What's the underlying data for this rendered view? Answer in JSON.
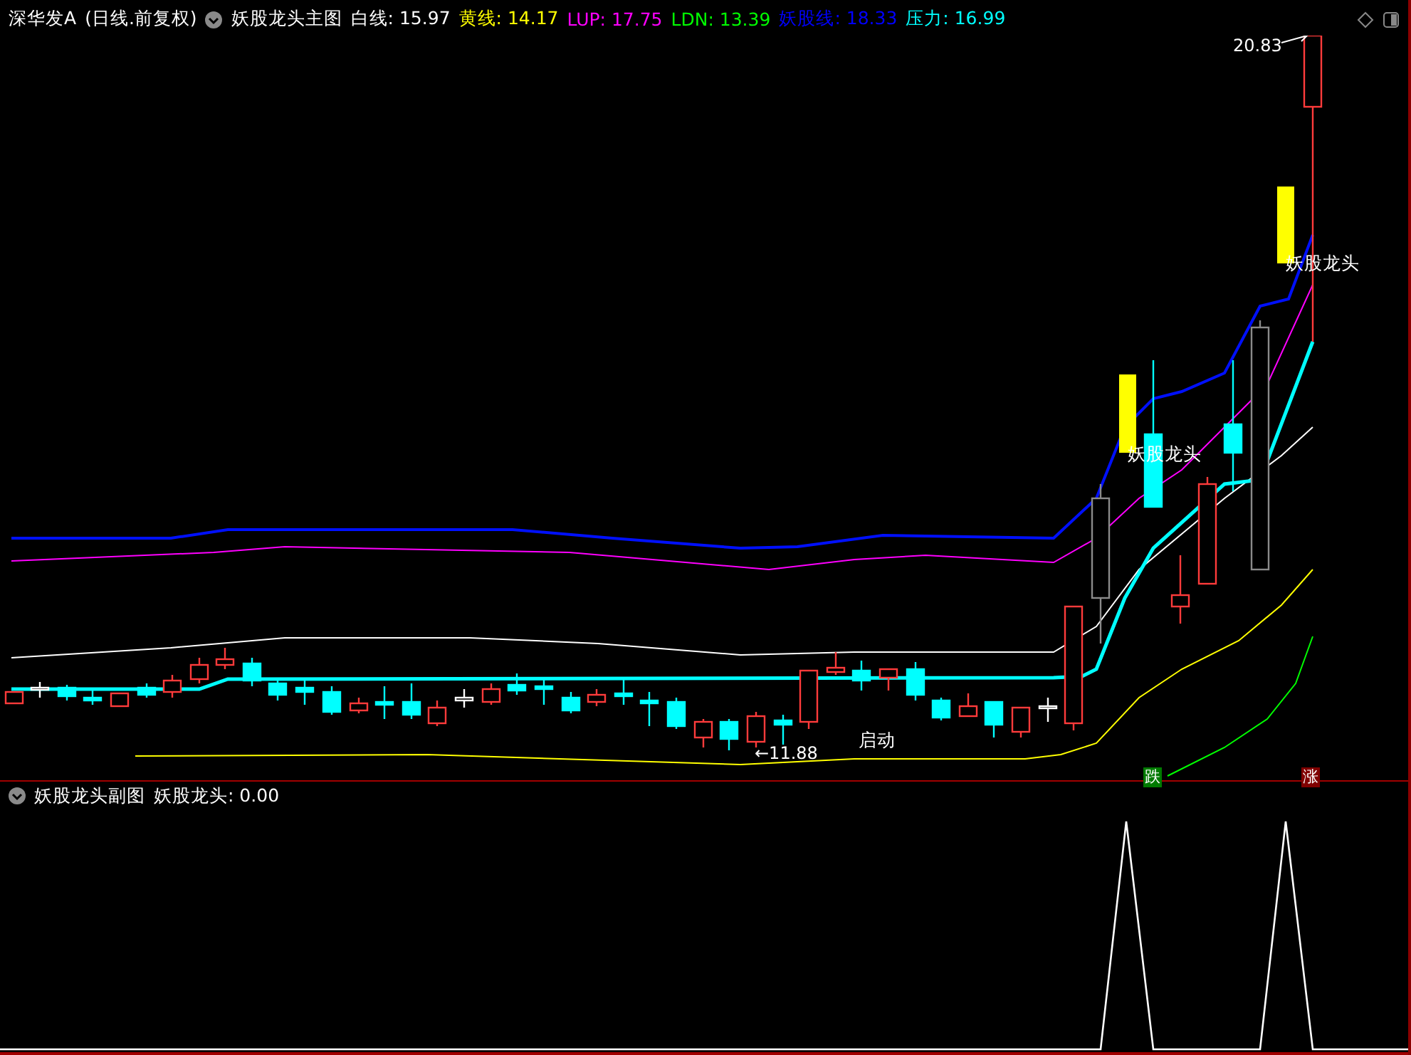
{
  "main_header": {
    "stock": "深华发A",
    "period": "(日线.前复权)",
    "indicator": "妖股龙头主图",
    "readouts": [
      {
        "label": "白线:",
        "value": "15.97",
        "color": "#ffffff"
      },
      {
        "label": "黄线:",
        "value": "14.17",
        "color": "#ffff00"
      },
      {
        "label": "LUP:",
        "value": "17.75",
        "color": "#ff00ff"
      },
      {
        "label": "LDN:",
        "value": "13.39",
        "color": "#00ff00"
      },
      {
        "label": "妖股线:",
        "value": "18.33",
        "color": "#0000ff"
      },
      {
        "label": "压力:",
        "value": "16.99",
        "color": "#00ffff"
      }
    ]
  },
  "main_chart": {
    "high_label": "20.83",
    "low_label": "←11.88",
    "annotations": [
      {
        "text": "妖股龙头"
      },
      {
        "text": "妖股龙头"
      },
      {
        "text": "启动"
      }
    ],
    "badges": [
      {
        "text": "跌",
        "color": "#007a00"
      },
      {
        "text": "涨",
        "color": "#800000"
      }
    ]
  },
  "sub_header": {
    "indicator": "妖股龙头副图",
    "readouts": [
      {
        "label": "妖股龙头:",
        "value": "0.00",
        "color": "#ffffff"
      }
    ]
  }
}
